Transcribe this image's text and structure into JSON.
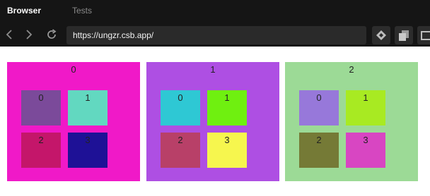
{
  "tabs": [
    {
      "label": "Browser",
      "active": true
    },
    {
      "label": "Tests",
      "active": false
    }
  ],
  "nav": {
    "back_icon": "chevron-left-icon",
    "forward_icon": "chevron-right-icon",
    "reload_icon": "reload-icon",
    "url": "https://ungzr.csb.app/"
  },
  "tools": [
    "devtools-icon",
    "copy-icon",
    "window-icon"
  ],
  "panels": [
    {
      "label": "0",
      "color": "#f019c8",
      "boxes": [
        {
          "label": "0",
          "color": "#7b4a9a"
        },
        {
          "label": "1",
          "color": "#62d8c0"
        },
        {
          "label": "2",
          "color": "#c4166a"
        },
        {
          "label": "3",
          "color": "#1e1196"
        }
      ]
    },
    {
      "label": "1",
      "color": "#ae4fe3",
      "boxes": [
        {
          "label": "0",
          "color": "#2ec8d4"
        },
        {
          "label": "1",
          "color": "#6ff010"
        },
        {
          "label": "2",
          "color": "#b84068"
        },
        {
          "label": "3",
          "color": "#f6f64e"
        }
      ]
    },
    {
      "label": "2",
      "color": "#9cda96",
      "boxes": [
        {
          "label": "0",
          "color": "#9778da"
        },
        {
          "label": "1",
          "color": "#a8ea22"
        },
        {
          "label": "2",
          "color": "#757a36"
        },
        {
          "label": "3",
          "color": "#d846c2"
        }
      ]
    }
  ]
}
